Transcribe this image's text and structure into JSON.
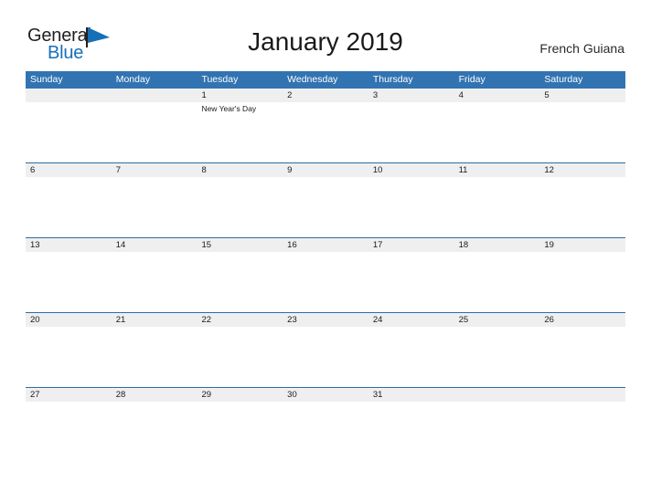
{
  "brand": {
    "name_part1": "General",
    "name_part2": "Blue",
    "logo_icon": "blue-flag-triangle-icon",
    "accent_color": "#1670b8"
  },
  "header": {
    "title": "January 2019",
    "region": "French Guiana"
  },
  "theme": {
    "header_blue": "#3273b2",
    "rule_blue": "#2b6ca8",
    "daynum_gray": "#efefef",
    "text_dark": "#1a1a1a"
  },
  "calendar": {
    "month": "January",
    "year": "2019",
    "weekday_headers": [
      "Sunday",
      "Monday",
      "Tuesday",
      "Wednesday",
      "Thursday",
      "Friday",
      "Saturday"
    ],
    "weeks": [
      {
        "rule": false,
        "days": [
          {
            "num": "",
            "events": []
          },
          {
            "num": "",
            "events": []
          },
          {
            "num": "1",
            "events": [
              "New Year's Day"
            ]
          },
          {
            "num": "2",
            "events": []
          },
          {
            "num": "3",
            "events": []
          },
          {
            "num": "4",
            "events": []
          },
          {
            "num": "5",
            "events": []
          }
        ]
      },
      {
        "rule": true,
        "days": [
          {
            "num": "6",
            "events": []
          },
          {
            "num": "7",
            "events": []
          },
          {
            "num": "8",
            "events": []
          },
          {
            "num": "9",
            "events": []
          },
          {
            "num": "10",
            "events": []
          },
          {
            "num": "11",
            "events": []
          },
          {
            "num": "12",
            "events": []
          }
        ]
      },
      {
        "rule": true,
        "days": [
          {
            "num": "13",
            "events": []
          },
          {
            "num": "14",
            "events": []
          },
          {
            "num": "15",
            "events": []
          },
          {
            "num": "16",
            "events": []
          },
          {
            "num": "17",
            "events": []
          },
          {
            "num": "18",
            "events": []
          },
          {
            "num": "19",
            "events": []
          }
        ]
      },
      {
        "rule": true,
        "days": [
          {
            "num": "20",
            "events": []
          },
          {
            "num": "21",
            "events": []
          },
          {
            "num": "22",
            "events": []
          },
          {
            "num": "23",
            "events": []
          },
          {
            "num": "24",
            "events": []
          },
          {
            "num": "25",
            "events": []
          },
          {
            "num": "26",
            "events": []
          }
        ]
      },
      {
        "rule": true,
        "days": [
          {
            "num": "27",
            "events": []
          },
          {
            "num": "28",
            "events": []
          },
          {
            "num": "29",
            "events": []
          },
          {
            "num": "30",
            "events": []
          },
          {
            "num": "31",
            "events": []
          },
          {
            "num": "",
            "events": []
          },
          {
            "num": "",
            "events": []
          }
        ]
      }
    ]
  }
}
